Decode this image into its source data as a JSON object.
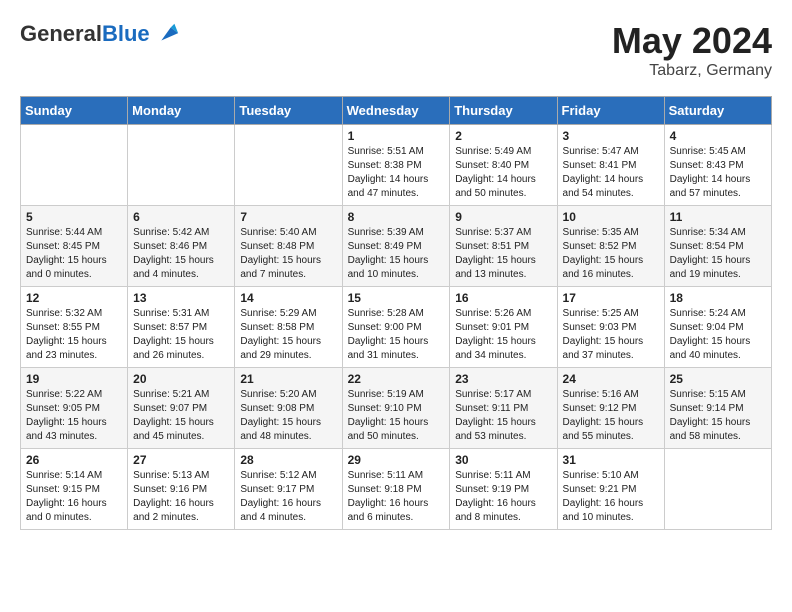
{
  "header": {
    "logo_general": "General",
    "logo_blue": "Blue",
    "month_year": "May 2024",
    "location": "Tabarz, Germany"
  },
  "days_of_week": [
    "Sunday",
    "Monday",
    "Tuesday",
    "Wednesday",
    "Thursday",
    "Friday",
    "Saturday"
  ],
  "weeks": [
    [
      {
        "day": "",
        "info": ""
      },
      {
        "day": "",
        "info": ""
      },
      {
        "day": "",
        "info": ""
      },
      {
        "day": "1",
        "info": "Sunrise: 5:51 AM\nSunset: 8:38 PM\nDaylight: 14 hours\nand 47 minutes."
      },
      {
        "day": "2",
        "info": "Sunrise: 5:49 AM\nSunset: 8:40 PM\nDaylight: 14 hours\nand 50 minutes."
      },
      {
        "day": "3",
        "info": "Sunrise: 5:47 AM\nSunset: 8:41 PM\nDaylight: 14 hours\nand 54 minutes."
      },
      {
        "day": "4",
        "info": "Sunrise: 5:45 AM\nSunset: 8:43 PM\nDaylight: 14 hours\nand 57 minutes."
      }
    ],
    [
      {
        "day": "5",
        "info": "Sunrise: 5:44 AM\nSunset: 8:45 PM\nDaylight: 15 hours\nand 0 minutes."
      },
      {
        "day": "6",
        "info": "Sunrise: 5:42 AM\nSunset: 8:46 PM\nDaylight: 15 hours\nand 4 minutes."
      },
      {
        "day": "7",
        "info": "Sunrise: 5:40 AM\nSunset: 8:48 PM\nDaylight: 15 hours\nand 7 minutes."
      },
      {
        "day": "8",
        "info": "Sunrise: 5:39 AM\nSunset: 8:49 PM\nDaylight: 15 hours\nand 10 minutes."
      },
      {
        "day": "9",
        "info": "Sunrise: 5:37 AM\nSunset: 8:51 PM\nDaylight: 15 hours\nand 13 minutes."
      },
      {
        "day": "10",
        "info": "Sunrise: 5:35 AM\nSunset: 8:52 PM\nDaylight: 15 hours\nand 16 minutes."
      },
      {
        "day": "11",
        "info": "Sunrise: 5:34 AM\nSunset: 8:54 PM\nDaylight: 15 hours\nand 19 minutes."
      }
    ],
    [
      {
        "day": "12",
        "info": "Sunrise: 5:32 AM\nSunset: 8:55 PM\nDaylight: 15 hours\nand 23 minutes."
      },
      {
        "day": "13",
        "info": "Sunrise: 5:31 AM\nSunset: 8:57 PM\nDaylight: 15 hours\nand 26 minutes."
      },
      {
        "day": "14",
        "info": "Sunrise: 5:29 AM\nSunset: 8:58 PM\nDaylight: 15 hours\nand 29 minutes."
      },
      {
        "day": "15",
        "info": "Sunrise: 5:28 AM\nSunset: 9:00 PM\nDaylight: 15 hours\nand 31 minutes."
      },
      {
        "day": "16",
        "info": "Sunrise: 5:26 AM\nSunset: 9:01 PM\nDaylight: 15 hours\nand 34 minutes."
      },
      {
        "day": "17",
        "info": "Sunrise: 5:25 AM\nSunset: 9:03 PM\nDaylight: 15 hours\nand 37 minutes."
      },
      {
        "day": "18",
        "info": "Sunrise: 5:24 AM\nSunset: 9:04 PM\nDaylight: 15 hours\nand 40 minutes."
      }
    ],
    [
      {
        "day": "19",
        "info": "Sunrise: 5:22 AM\nSunset: 9:05 PM\nDaylight: 15 hours\nand 43 minutes."
      },
      {
        "day": "20",
        "info": "Sunrise: 5:21 AM\nSunset: 9:07 PM\nDaylight: 15 hours\nand 45 minutes."
      },
      {
        "day": "21",
        "info": "Sunrise: 5:20 AM\nSunset: 9:08 PM\nDaylight: 15 hours\nand 48 minutes."
      },
      {
        "day": "22",
        "info": "Sunrise: 5:19 AM\nSunset: 9:10 PM\nDaylight: 15 hours\nand 50 minutes."
      },
      {
        "day": "23",
        "info": "Sunrise: 5:17 AM\nSunset: 9:11 PM\nDaylight: 15 hours\nand 53 minutes."
      },
      {
        "day": "24",
        "info": "Sunrise: 5:16 AM\nSunset: 9:12 PM\nDaylight: 15 hours\nand 55 minutes."
      },
      {
        "day": "25",
        "info": "Sunrise: 5:15 AM\nSunset: 9:14 PM\nDaylight: 15 hours\nand 58 minutes."
      }
    ],
    [
      {
        "day": "26",
        "info": "Sunrise: 5:14 AM\nSunset: 9:15 PM\nDaylight: 16 hours\nand 0 minutes."
      },
      {
        "day": "27",
        "info": "Sunrise: 5:13 AM\nSunset: 9:16 PM\nDaylight: 16 hours\nand 2 minutes."
      },
      {
        "day": "28",
        "info": "Sunrise: 5:12 AM\nSunset: 9:17 PM\nDaylight: 16 hours\nand 4 minutes."
      },
      {
        "day": "29",
        "info": "Sunrise: 5:11 AM\nSunset: 9:18 PM\nDaylight: 16 hours\nand 6 minutes."
      },
      {
        "day": "30",
        "info": "Sunrise: 5:11 AM\nSunset: 9:19 PM\nDaylight: 16 hours\nand 8 minutes."
      },
      {
        "day": "31",
        "info": "Sunrise: 5:10 AM\nSunset: 9:21 PM\nDaylight: 16 hours\nand 10 minutes."
      },
      {
        "day": "",
        "info": ""
      }
    ]
  ]
}
